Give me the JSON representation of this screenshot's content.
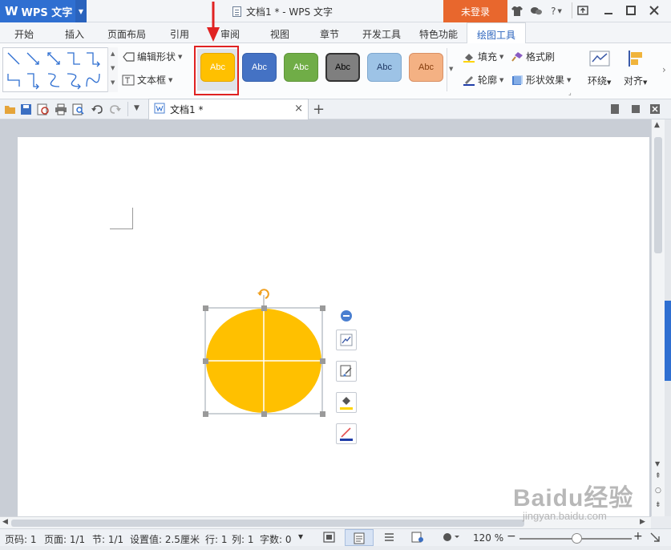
{
  "titlebar": {
    "app_logo": "W",
    "app_name": "WPS 文字",
    "doc_title": "文档1 * - WPS 文字",
    "login_label": "未登录",
    "icons": [
      "shirt-icon",
      "chat-icon",
      "help-icon",
      "restore-icon",
      "minimize-icon",
      "maximize-icon",
      "close-icon"
    ],
    "help_label": "?"
  },
  "ribbon_tabs": [
    "开始",
    "插入",
    "页面布局",
    "引用",
    "审阅",
    "视图",
    "章节",
    "开发工具",
    "特色功能",
    "绘图工具"
  ],
  "active_tab": "绘图工具",
  "ribbon": {
    "edit_shape_label": "编辑形状",
    "textbox_label": "文本框",
    "style_label": "Abc",
    "styles": [
      {
        "fill": "#ffc000",
        "text": "#ffffff",
        "border": "#e6a800"
      },
      {
        "fill": "#4472c4",
        "text": "#ffffff",
        "border": "#3660ab"
      },
      {
        "fill": "#70ad47",
        "text": "#ffffff",
        "border": "#5f9539"
      },
      {
        "fill": "#7f7f7f",
        "text": "#000000",
        "border": "#333333"
      },
      {
        "fill": "#9dc3e6",
        "text": "#1f3864",
        "border": "#7fa8cf"
      },
      {
        "fill": "#f4b183",
        "text": "#843c0c",
        "border": "#d99066"
      }
    ],
    "fill_label": "填充",
    "format_brush_label": "格式刷",
    "outline_label": "轮廓",
    "shape_effect_label": "形状效果",
    "wrap_label": "环绕",
    "align_label": "对齐"
  },
  "document_tab": {
    "label": "文档1 *",
    "close": "×",
    "new_tab": "+"
  },
  "shape": {
    "fill_color": "#ffc000",
    "handle_color": "#9a9a9a"
  },
  "statusbar": {
    "page": "页码: 1",
    "pages": "页面: 1/1",
    "section": "节: 1/1",
    "setting": "设置值: 2.5厘米",
    "row": "行: 1",
    "col": "列: 1",
    "word_count": "字数: 0",
    "zoom": "120 %"
  },
  "watermark": {
    "main": "Baidu经验",
    "sub": "jingyan.baidu.com"
  },
  "colors": {
    "accent": "#2f6fd1",
    "login": "#e8672d",
    "highlight_frame": "#e02222"
  }
}
